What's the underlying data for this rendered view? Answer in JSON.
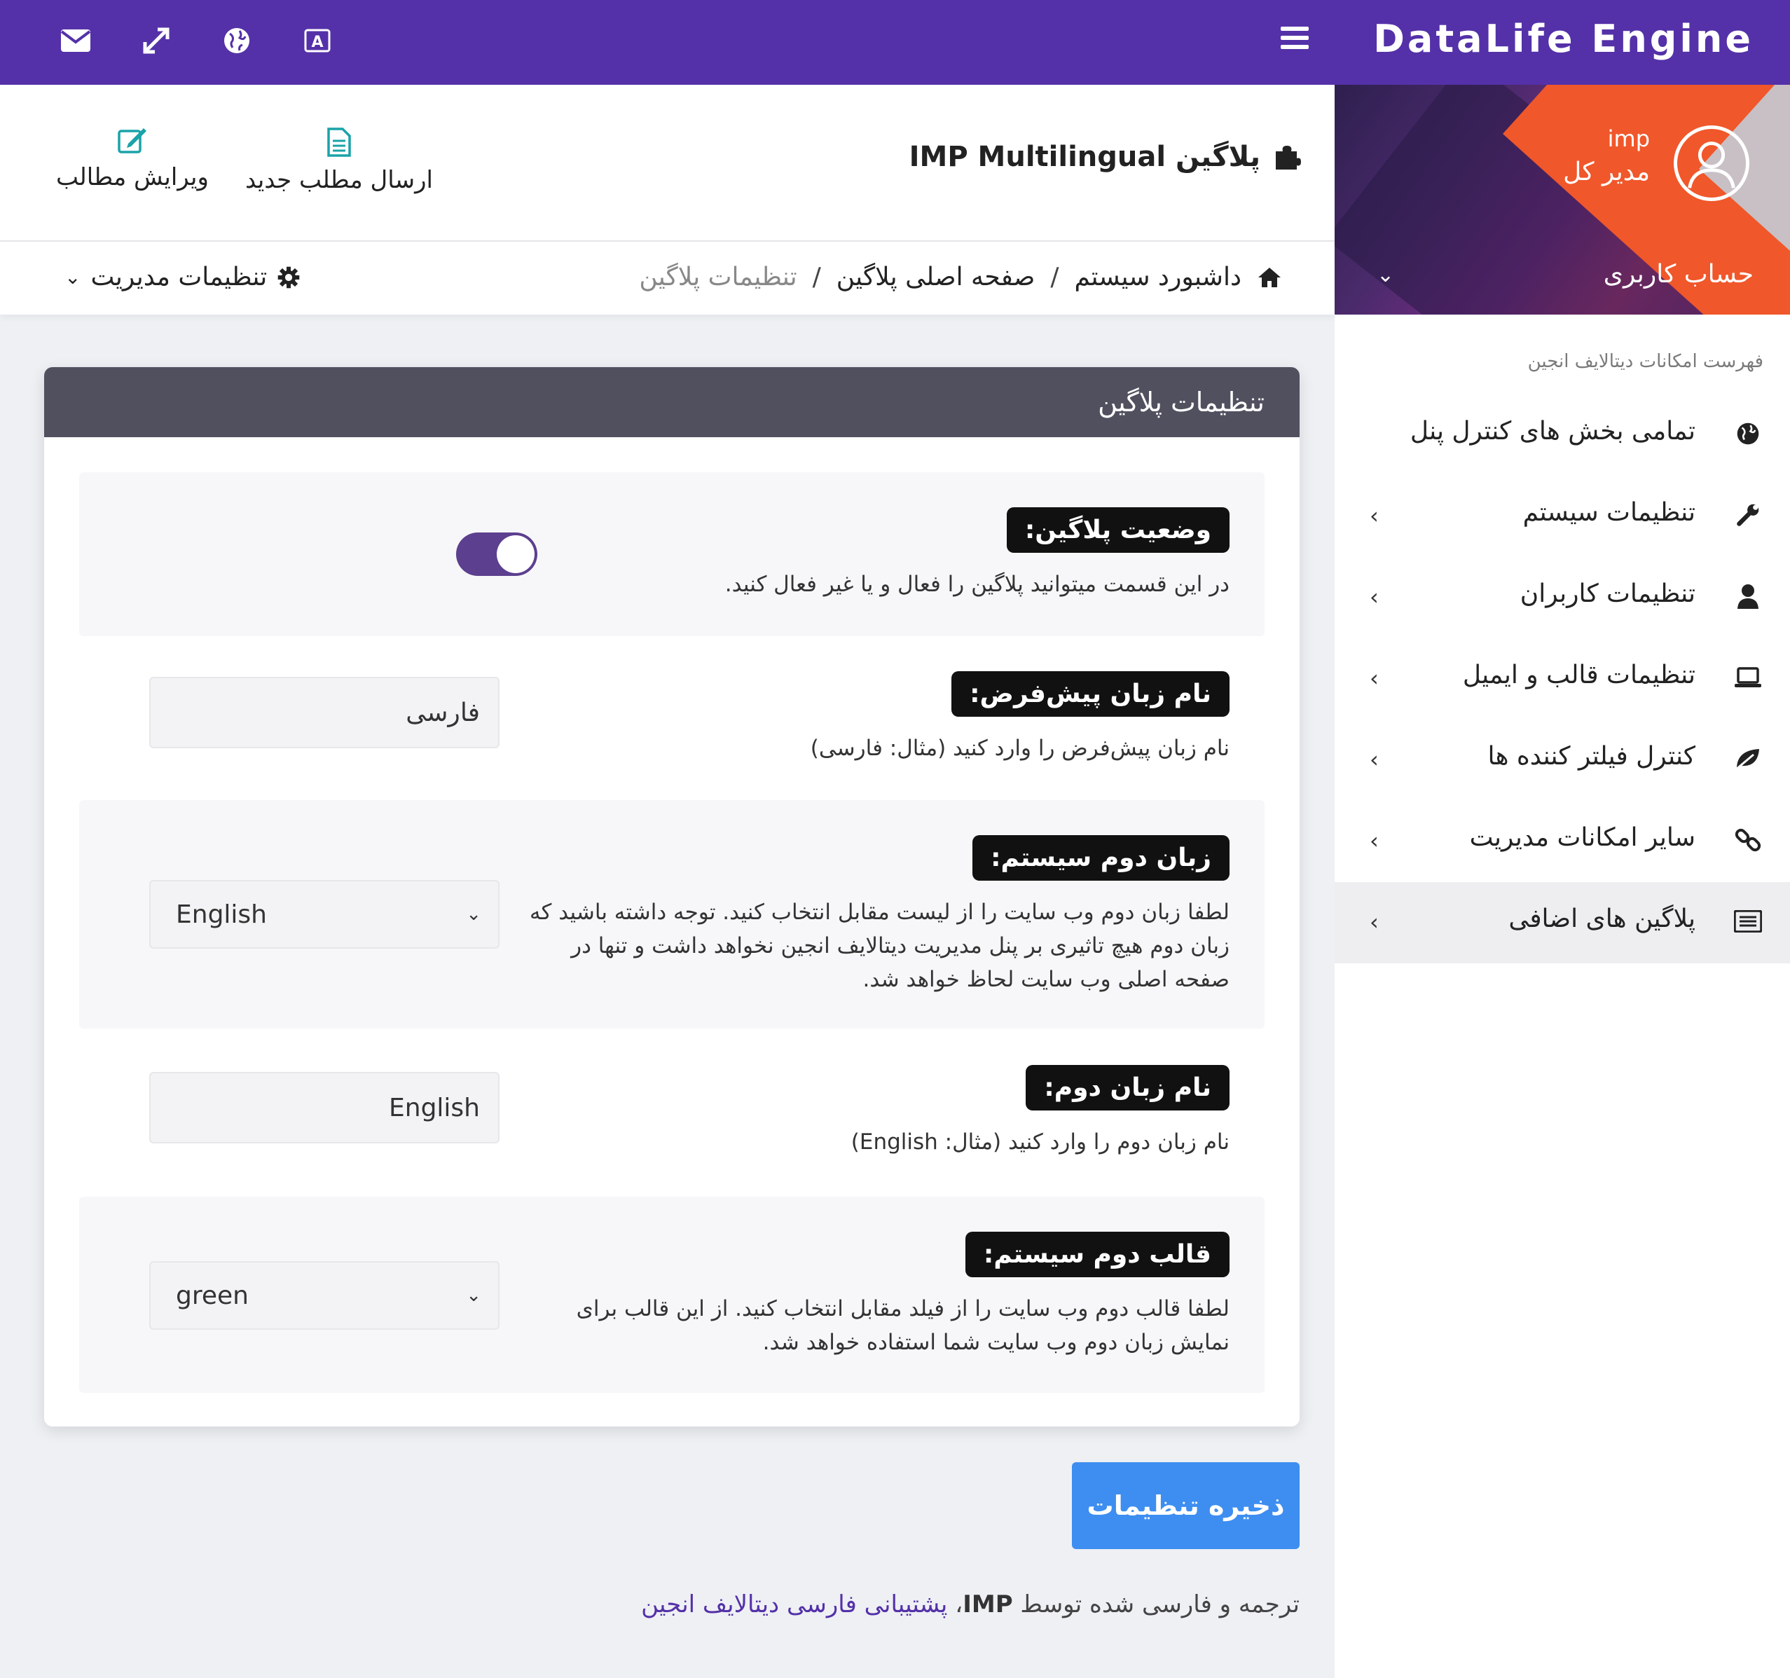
{
  "topbar": {
    "brand": "DataLife Engine",
    "icons": [
      "envelope-icon",
      "expand-icon",
      "globe-icon",
      "translate-icon",
      "hamburger-icon"
    ]
  },
  "profile": {
    "username": "imp",
    "role": "مدیر کل",
    "account_label": "حساب کاربری"
  },
  "sidebar": {
    "caption": "فهرست امکانات دیتالایف انجین",
    "items": [
      {
        "label": "تمامی بخش های کنترل پنل",
        "icon": "globe-icon",
        "has_arrow": false
      },
      {
        "label": "تنظیمات سیستم",
        "icon": "wrench-icon",
        "has_arrow": true
      },
      {
        "label": "تنظیمات کاربران",
        "icon": "user-icon",
        "has_arrow": true
      },
      {
        "label": "تنظیمات قالب و ایمیل",
        "icon": "laptop-icon",
        "has_arrow": true
      },
      {
        "label": "کنترل فیلتر کننده ها",
        "icon": "leaf-icon",
        "has_arrow": true
      },
      {
        "label": "سایر امکانات مدیریت",
        "icon": "link-icon",
        "has_arrow": true
      },
      {
        "label": "پلاگین های اضافی",
        "icon": "list-icon",
        "has_arrow": true
      }
    ]
  },
  "header": {
    "title": "پلاگین IMP Multilingual",
    "quick_links": [
      {
        "label": "ارسال مطلب جدید",
        "icon": "file-icon"
      },
      {
        "label": "ویرایش مطالب",
        "icon": "edit-icon"
      }
    ]
  },
  "breadcrumb": {
    "items": [
      "داشبورد سیستم",
      "صفحه اصلی پلاگین",
      "تنظیمات پلاگین"
    ],
    "admin_settings": "تنظیمات مدیریت"
  },
  "panel": {
    "title": "تنظیمات پلاگین",
    "rows": [
      {
        "label": "وضعیت پلاگین:",
        "desc": "در این قسمت میتوانید پلاگین را فعال و یا غیر فعال کنید.",
        "control": "toggle",
        "value": true
      },
      {
        "label": "نام زبان پیش‌فرض:",
        "desc": "نام زبان پیش‌فرض را وارد کنید (مثال: فارسی)",
        "control": "input",
        "value": "فارسی"
      },
      {
        "label": "زبان دوم سیستم:",
        "desc": "لطفا زبان دوم وب سایت را از لیست مقابل انتخاب کنید. توجه داشته باشید که زبان دوم هیچ تاثیری بر پنل مدیریت دیتالایف انجین نخواهد داشت و تنها در صفحه اصلی وب سایت لحاظ خواهد شد.",
        "control": "select",
        "value": "English"
      },
      {
        "label": "نام زبان دوم:",
        "desc": "نام زبان دوم را وارد کنید (مثال: English)",
        "control": "input",
        "value": "English"
      },
      {
        "label": "قالب دوم سیستم:",
        "desc": "لطفا قالب دوم وب سایت را از فیلد مقابل انتخاب کنید. از این قالب برای نمایش زبان دوم وب سایت شما استفاده خواهد شد.",
        "control": "select",
        "value": "green"
      }
    ]
  },
  "save_button": "ذخیره تنظیمات",
  "footer": {
    "prefix": "ترجمه و فارسی شده توسط",
    "author": "IMP",
    "sep": "،",
    "link": "پشتیبانی فارسی دیتالایف انجین"
  },
  "colors": {
    "topbar": "#5431a8",
    "panel_head": "#51505f",
    "save_button": "#3d8ef0",
    "toggle": "#5c3f8f",
    "badge": "#111111"
  }
}
